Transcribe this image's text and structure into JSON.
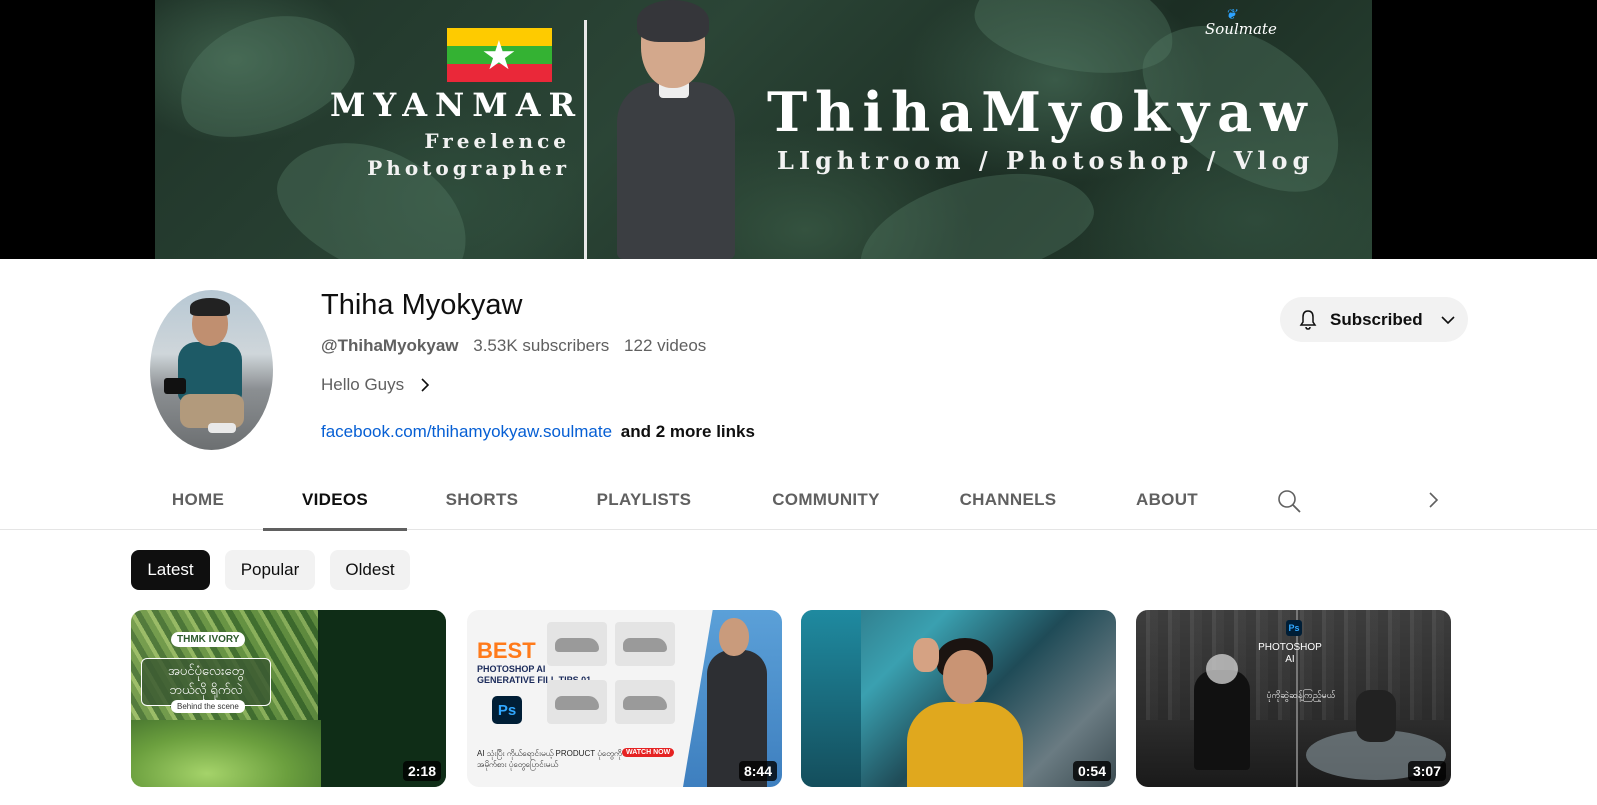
{
  "banner": {
    "left_title": "MYANMAR",
    "left_sub1": "Freelence",
    "left_sub2": "Photographer",
    "name": "ThihaMyokyaw",
    "tagline": "LIghtroom / Photoshop / Vlog",
    "logo": "Soulmate"
  },
  "channel": {
    "name": "Thiha Myokyaw",
    "handle": "@ThihaMyokyaw",
    "subscribers": "3.53K subscribers",
    "videos": "122 videos",
    "description": "Hello Guys",
    "link": "facebook.com/thihamyokyaw.soulmate",
    "more_links": "and 2 more links"
  },
  "subscribe": {
    "label": "Subscribed"
  },
  "tabs": [
    {
      "label": "HOME"
    },
    {
      "label": "VIDEOS"
    },
    {
      "label": "SHORTS"
    },
    {
      "label": "PLAYLISTS"
    },
    {
      "label": "COMMUNITY"
    },
    {
      "label": "CHANNELS"
    },
    {
      "label": "ABOUT"
    }
  ],
  "active_tab": "VIDEOS",
  "chips": [
    {
      "label": "Latest"
    },
    {
      "label": "Popular"
    },
    {
      "label": "Oldest"
    }
  ],
  "videos": [
    {
      "duration": "2:18",
      "thumb_tag": "THMK IVORY",
      "thumb_text": "အပင်ပုံလေးတွေ ဘယ်လို ရိုက်လဲ",
      "thumb_sub": "Behind the scene"
    },
    {
      "duration": "8:44",
      "thumb_big": "BEST",
      "thumb_line1": "PHOTOSHOP AI",
      "thumb_line2": "GENERATIVE FILL TIPS 01",
      "thumb_ps": "Ps",
      "thumb_text": "AI သုံးပြီး ကိုယ်ရောင်းမယ့် PRODUCT ပုံတွေကို အမိုက်စား ပုံတွေပြောင်းမယ်",
      "thumb_badge": "WATCH NOW"
    },
    {
      "duration": "0:54"
    },
    {
      "duration": "3:07",
      "thumb_ps": "Ps",
      "thumb_line1": "PHOTOSHOP",
      "thumb_line2": "AI",
      "thumb_text": "ပုံကိုဆွဲဆန့်ကြည့်မယ်"
    }
  ]
}
